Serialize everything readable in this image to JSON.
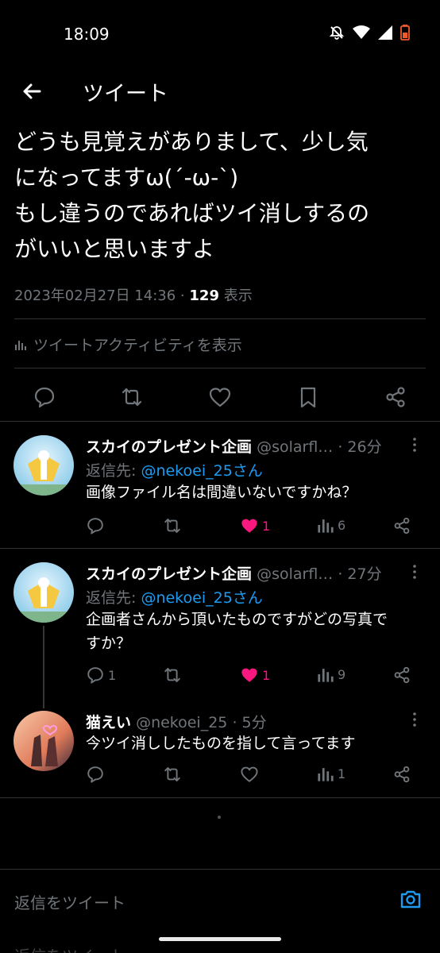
{
  "status_bar": {
    "time": "18:09"
  },
  "header": {
    "title": "ツイート"
  },
  "tweet": {
    "lines": [
      "どうも見覚えがありまして、少し気",
      "になってますω(´-ω-`)",
      "もし違うのであればツイ消しするの",
      "がいいと思いますよ"
    ],
    "timestamp": "2023年02月27日 14:36 · ",
    "views_count": "129",
    "views_label": " 表示",
    "activity_label": "ツイートアクティビティを表示"
  },
  "replies": [
    {
      "name": "スカイのプレゼント企画",
      "handle": "@solarfl…",
      "time": "· 26分",
      "reply_to_label": "返信先: ",
      "reply_to_mention": "@nekoei_25さん",
      "text": "画像ファイル名は間違いないですかね？",
      "reply_count": "",
      "like_count": "1",
      "view_count": "6"
    },
    {
      "name": "スカイのプレゼント企画",
      "handle": "@solarfl…",
      "time": "· 27分",
      "reply_to_label": "返信先: ",
      "reply_to_mention": "@nekoei_25さん",
      "text_lines": [
        "企画者さんから頂いたものですがどの写真で",
        "すか？"
      ],
      "reply_count": "1",
      "like_count": "1",
      "view_count": "9"
    },
    {
      "name": "猫えい",
      "handle": "@nekoei_25",
      "time": "· 5分",
      "text": "今ツイ消ししたものを指して言ってます",
      "reply_count": "",
      "like_count": "",
      "view_count": "1"
    }
  ],
  "composer": {
    "placeholder": "返信をツイート",
    "second_placeholder": "返信をツイート"
  },
  "colors": {
    "accent": "#1d9bf0",
    "like": "#f91880",
    "muted": "#71767b",
    "background": "#000000"
  }
}
